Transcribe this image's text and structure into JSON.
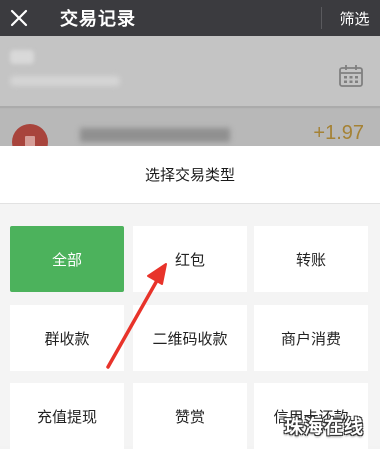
{
  "header": {
    "title": "交易记录",
    "filter_label": "筛选"
  },
  "background": {
    "transaction_amount": "+1.97"
  },
  "sheet": {
    "title": "选择交易类型",
    "options": [
      {
        "label": "全部",
        "selected": true
      },
      {
        "label": "红包",
        "selected": false
      },
      {
        "label": "转账",
        "selected": false
      },
      {
        "label": "群收款",
        "selected": false
      },
      {
        "label": "二维码收款",
        "selected": false
      },
      {
        "label": "商户消费",
        "selected": false
      },
      {
        "label": "充值提现",
        "selected": false
      },
      {
        "label": "赞赏",
        "selected": false
      },
      {
        "label": "信用卡还款",
        "selected": false
      }
    ]
  },
  "watermark": "珠海在线",
  "colors": {
    "topbar": "#3b3b3f",
    "selected": "#4cb25c",
    "amount": "#a58235",
    "arrow": "#e8332a"
  },
  "icons": {
    "close": "close-icon",
    "calendar": "calendar-icon",
    "arrow": "annotation-arrow"
  }
}
